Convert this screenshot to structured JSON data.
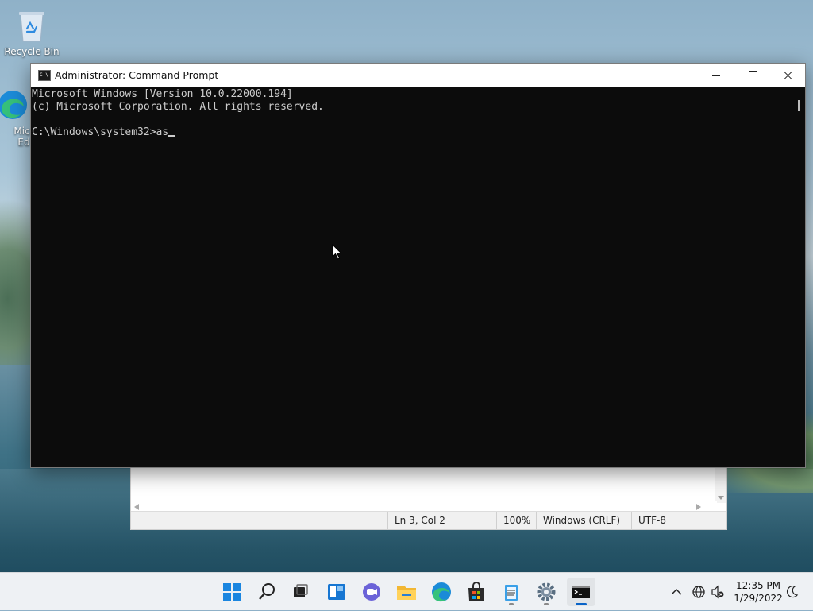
{
  "desktop": {
    "icons": [
      {
        "label": "Recycle Bin"
      },
      {
        "label": "Micr\nEd"
      }
    ]
  },
  "cmd": {
    "title": "Administrator: Command Prompt",
    "icon_text": "C:\\",
    "lines": [
      "Microsoft Windows [Version 10.0.22000.194]",
      "(c) Microsoft Corporation. All rights reserved.",
      "",
      "C:\\Windows\\system32>as"
    ]
  },
  "notepad": {
    "status": {
      "position": "Ln 3, Col 2",
      "zoom": "100%",
      "line_ending": "Windows (CRLF)",
      "encoding": "UTF-8"
    }
  },
  "taskbar": {
    "items": [
      "start-icon",
      "search-icon",
      "task-view-icon",
      "widgets-icon",
      "chat-icon",
      "file-explorer-icon",
      "edge-icon",
      "store-icon",
      "notepad-icon",
      "settings-icon",
      "terminal-icon"
    ],
    "clock": {
      "time": "12:35 PM",
      "date": "1/29/2022"
    }
  },
  "colors": {
    "accent": "#0a64c8",
    "console_bg": "#0c0c0c",
    "console_fg": "#cccccc"
  }
}
